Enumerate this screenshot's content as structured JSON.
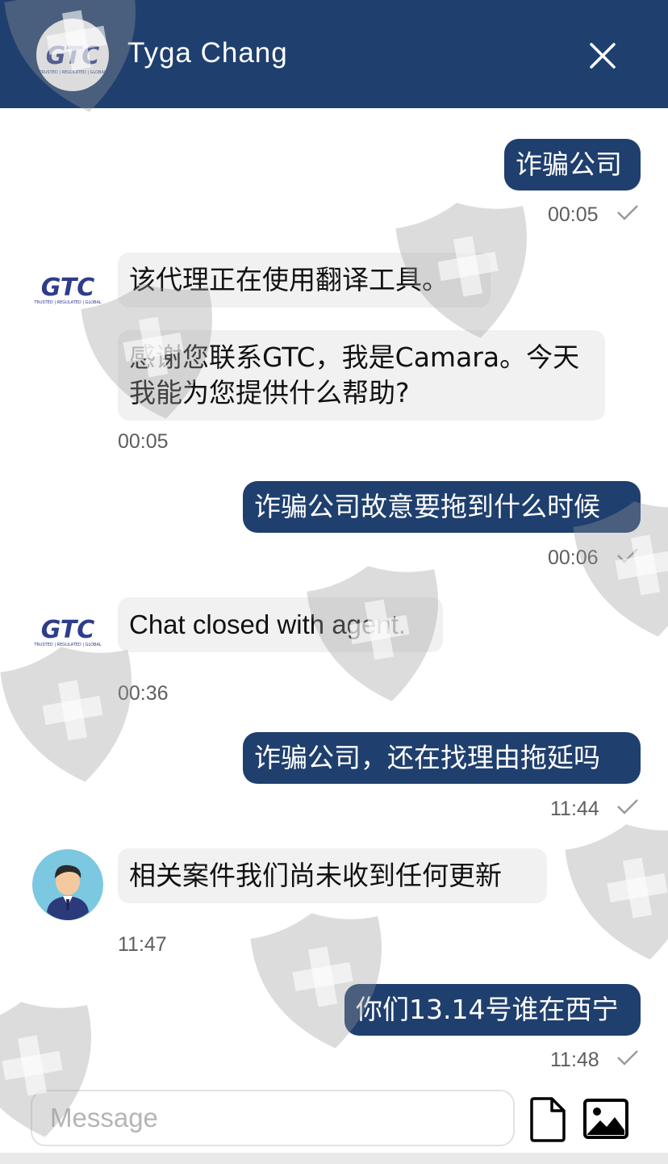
{
  "header": {
    "title": "Tyga Chang",
    "logo_text": "GTC",
    "logo_tagline": "TRUSTED | REGULATED | GLOBAL",
    "close_icon": "close-icon"
  },
  "messages": [
    {
      "direction": "out",
      "text": "诈骗公司",
      "time": "00:05",
      "status_icon": "check-icon"
    },
    {
      "direction": "in",
      "sender_icon": "gtc-logo",
      "texts": [
        "该代理正在使用翻译工具。",
        "感谢您联系GTC，我是Camara。今天我能为您提供什么帮助?"
      ],
      "time": "00:05"
    },
    {
      "direction": "out",
      "text": "诈骗公司故意要拖到什么时候",
      "time": "00:06",
      "status_icon": "check-icon"
    },
    {
      "direction": "in",
      "sender_icon": "gtc-logo",
      "texts": [
        "Chat closed with agent."
      ],
      "time": "00:36"
    },
    {
      "direction": "out",
      "text": "诈骗公司，还在找理由拖延吗",
      "time": "11:44",
      "status_icon": "check-icon"
    },
    {
      "direction": "in",
      "sender_icon": "agent-avatar",
      "texts": [
        "相关案件我们尚未收到任何更新"
      ],
      "time": "11:47"
    },
    {
      "direction": "out",
      "text": "你们13.14号谁在西宁",
      "time": "11:48",
      "status_icon": "check-icon"
    }
  ],
  "composer": {
    "placeholder": "Message",
    "file_icon": "file-icon",
    "image_icon": "image-icon"
  },
  "colors": {
    "header": "#1f3f6e",
    "outgoing_bubble": "#1f3f6e",
    "incoming_bubble": "#f1f1f1",
    "logo_blue": "#2e3c8c"
  }
}
